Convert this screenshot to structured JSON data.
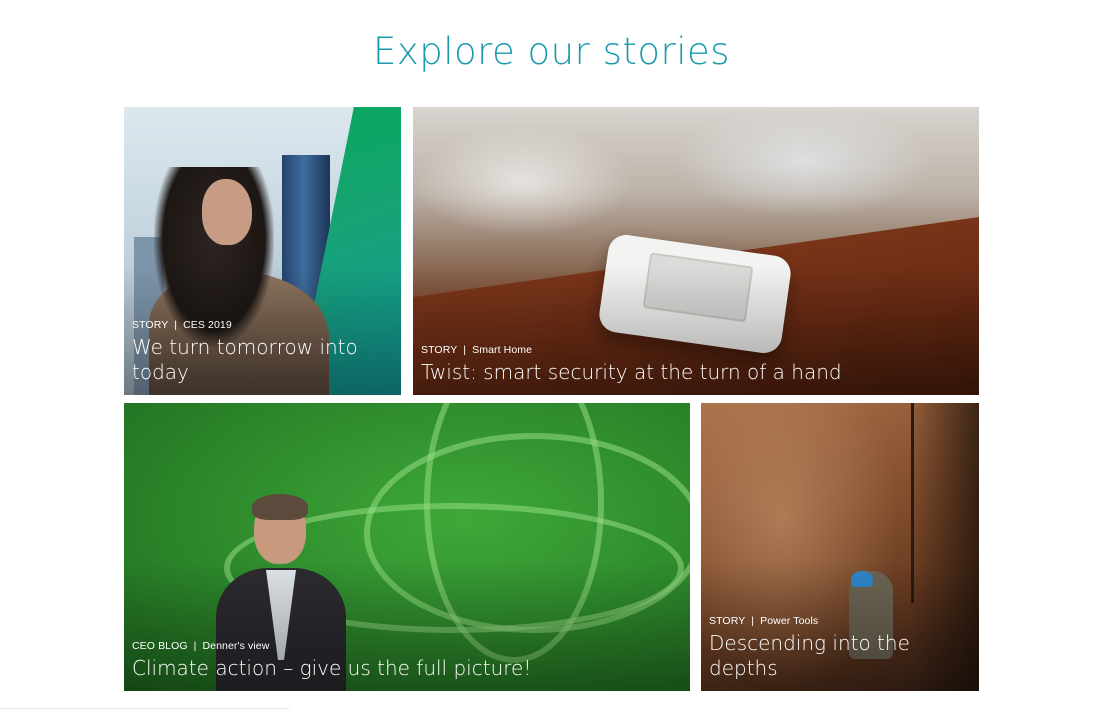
{
  "section": {
    "title": "Explore our stories"
  },
  "tiles": [
    {
      "category": "STORY",
      "tag": "CES 2019",
      "headline": "We turn tomorrow into today"
    },
    {
      "category": "STORY",
      "tag": "Smart Home",
      "headline": "Twist: smart security at the turn of a hand"
    },
    {
      "category": "CEO BLOG",
      "tag": "Denner's view",
      "headline": "Climate action – give us the full picture!"
    },
    {
      "category": "STORY",
      "tag": "Power Tools",
      "headline": "Descending into the depths"
    }
  ],
  "separator": "|",
  "colors": {
    "title": "#1a9bad",
    "brand_green": "#00a94f"
  }
}
